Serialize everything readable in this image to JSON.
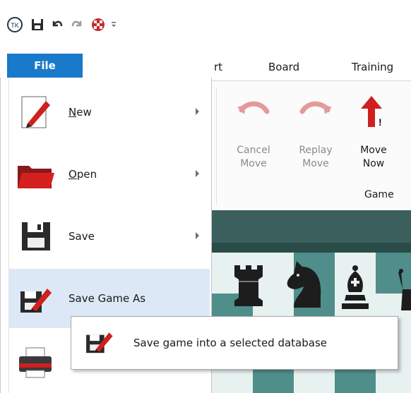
{
  "quick_access": {
    "icons": [
      "app-logo-icon",
      "save-icon",
      "undo-icon",
      "redo-icon",
      "engine-icon",
      "customize-dropdown-icon"
    ]
  },
  "ribbon": {
    "tabs": [
      {
        "label": "rt"
      },
      {
        "label": "Board"
      },
      {
        "label": "Training"
      }
    ],
    "buttons": [
      {
        "label": "Cancel\nMove",
        "enabled": false
      },
      {
        "label": "Replay\nMove",
        "enabled": false
      },
      {
        "label": "Move\nNow",
        "enabled": true
      }
    ],
    "group_label": "Game"
  },
  "file_menu": {
    "tab_label": "File",
    "items": [
      {
        "label_underlined": "N",
        "label_rest": "ew",
        "has_submenu": true
      },
      {
        "label_underlined": "O",
        "label_rest": "pen",
        "has_submenu": true
      },
      {
        "label": "Save",
        "has_submenu": true
      },
      {
        "label": "Save Game As",
        "has_submenu": false,
        "highlighted": true
      },
      {
        "label": "",
        "has_submenu": false
      }
    ]
  },
  "tooltip": {
    "text": "Save game into a selected database"
  },
  "colors": {
    "file_tab": "#1979ca",
    "hover": "#dce8f5",
    "board_dark": "#4f8e8a",
    "board_light": "#e7f1ef"
  }
}
